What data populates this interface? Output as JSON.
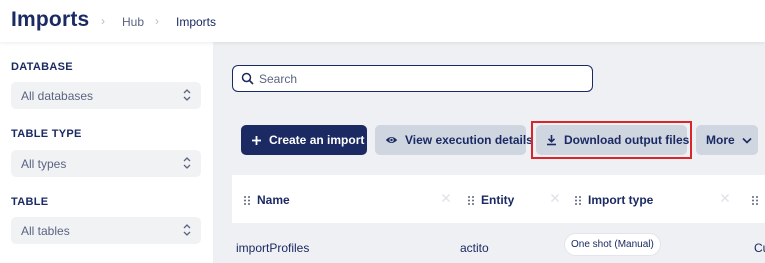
{
  "header": {
    "title": "Imports",
    "breadcrumb": [
      "Hub",
      "Imports"
    ]
  },
  "sidebar": {
    "filters": [
      {
        "label": "DATABASE",
        "value": "All databases"
      },
      {
        "label": "TABLE TYPE",
        "value": "All types"
      },
      {
        "label": "TABLE",
        "value": "All tables"
      }
    ]
  },
  "search": {
    "placeholder": "Search",
    "value": ""
  },
  "toolbar": {
    "create": "Create an import",
    "view": "View execution details",
    "download": "Download output files",
    "more": "More"
  },
  "table": {
    "columns": [
      "Name",
      "Entity",
      "Import type"
    ],
    "rows": [
      {
        "name": "importProfiles",
        "entity": "actito",
        "import_type": "One shot (Manual)",
        "extra": "Cust"
      }
    ]
  },
  "colors": {
    "primary": "#1b2a63",
    "secondary_button": "#cfd6e0",
    "highlight": "#d9262b",
    "main_bg": "#eef0f3"
  }
}
